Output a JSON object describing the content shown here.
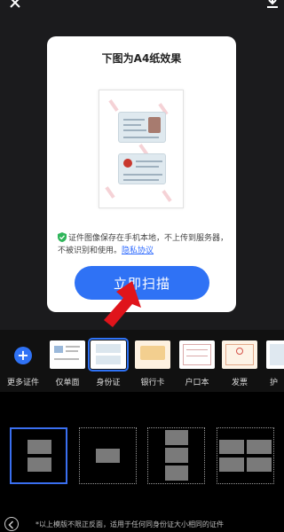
{
  "dialog": {
    "title": "下图为A4纸效果",
    "notice_text": "证件图像保存在手机本地，不上传到服务器，不被识别和使用。",
    "privacy_link": "隐私协议",
    "scan_button": "立即扫描"
  },
  "doc_types": [
    {
      "label": "更多证件",
      "icon": "plus-icon"
    },
    {
      "label": "仅单面",
      "icon": "single-side-thumb"
    },
    {
      "label": "身份证",
      "icon": "id-card-thumb",
      "selected": true
    },
    {
      "label": "银行卡",
      "icon": "bank-card-thumb"
    },
    {
      "label": "户口本",
      "icon": "household-book-thumb"
    },
    {
      "label": "发票",
      "icon": "invoice-thumb"
    },
    {
      "label": "护",
      "icon": "passport-thumb"
    }
  ],
  "footer": {
    "note": "*以上模版不限正反面，适用于任何同身份证大小相同的证件"
  },
  "colors": {
    "accent": "#2f72f5",
    "arrow": "#e0141b",
    "link": "#2f6bff"
  }
}
